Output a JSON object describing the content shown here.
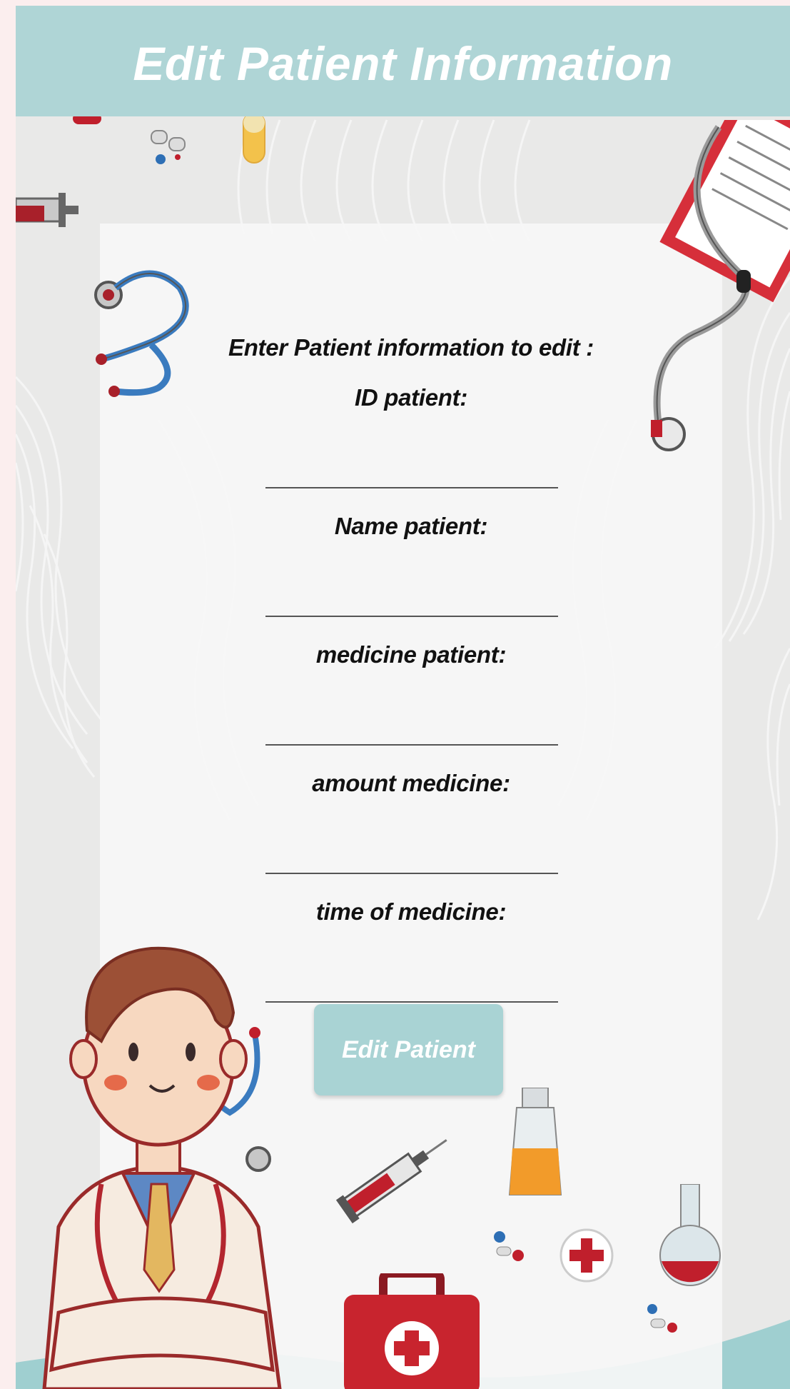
{
  "app_bar": {
    "title": "Edit Patient Information"
  },
  "form": {
    "heading": "Enter Patient information to edit :",
    "fields": [
      {
        "label": "ID patient:",
        "value": "",
        "placeholder": ""
      },
      {
        "label": "Name patient:",
        "value": "",
        "placeholder": ""
      },
      {
        "label": "medicine patient:",
        "value": "",
        "placeholder": ""
      },
      {
        "label": "amount medicine:",
        "value": "",
        "placeholder": ""
      },
      {
        "label": "time of medicine:",
        "value": "",
        "placeholder": ""
      }
    ],
    "submit_label": "Edit Patient"
  },
  "theme": {
    "accent": "#afd5d6",
    "button": "#a9d3d4",
    "background": "#e9e9e8",
    "panel": "#f6f6f6"
  },
  "decorations": [
    "stethoscope-icon",
    "clipboard-icon",
    "syringe-icon",
    "pills-icon",
    "capsule-icon",
    "medicine-bottle-icon",
    "flask-icon",
    "plus-icon",
    "first-aid-kit-icon",
    "doctor-illustration"
  ]
}
